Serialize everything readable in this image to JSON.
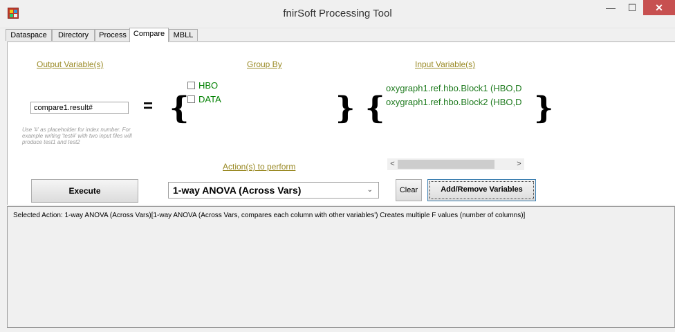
{
  "window": {
    "title": "fnirSoft Processing Tool",
    "controls": {
      "minimize": "—",
      "maximize": "☐",
      "close": "✕"
    }
  },
  "tabs": [
    "Dataspace",
    "Directory",
    "Process",
    "Compare",
    "MBLL"
  ],
  "active_tab": "Compare",
  "compare": {
    "output_header": "Output Variable(s)",
    "group_header": "Group By",
    "input_header": "Input Variable(s)",
    "actions_header": "Action(s) to perform",
    "output_value": "compare1.result#",
    "equals": "=",
    "open_brace": "{",
    "close_brace": "}",
    "hint": "Use '#' as placeholder for index number. For example writing 'test#' with two input files will produce test1 and test2",
    "group_options": [
      {
        "label": "HBO",
        "checked": false
      },
      {
        "label": "DATA",
        "checked": false
      }
    ],
    "input_variables": [
      "oxygraph1.ref.hbo.Block1 (HBO,D",
      "oxygraph1.ref.hbo.Block2 (HBO,D"
    ],
    "scroll_left": "<",
    "scroll_right": ">",
    "execute_label": "Execute",
    "selected_action": "1-way ANOVA (Across Vars)",
    "clear_label": "Clear",
    "add_remove_label": "Add/Remove Variables",
    "result_text": "Selected Action: 1-way ANOVA (Across Vars)[1-way ANOVA (Across Vars, compares each column with other variables') Creates multiple F values (number of columns)]"
  },
  "colors": {
    "header": "#9a8a26",
    "input_var": "#1d7a1d",
    "close_button": "#c75050"
  }
}
